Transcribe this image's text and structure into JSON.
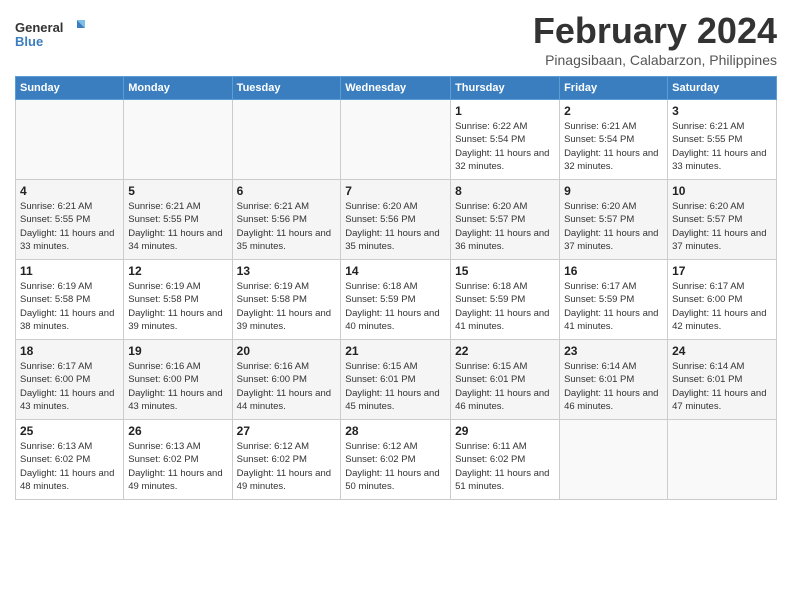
{
  "header": {
    "logo_line1": "General",
    "logo_line2": "Blue",
    "main_title": "February 2024",
    "subtitle": "Pinagsibaan, Calabarzon, Philippines"
  },
  "days_of_week": [
    "Sunday",
    "Monday",
    "Tuesday",
    "Wednesday",
    "Thursday",
    "Friday",
    "Saturday"
  ],
  "weeks": [
    [
      {
        "date": "",
        "sunrise": "",
        "sunset": "",
        "daylight": ""
      },
      {
        "date": "",
        "sunrise": "",
        "sunset": "",
        "daylight": ""
      },
      {
        "date": "",
        "sunrise": "",
        "sunset": "",
        "daylight": ""
      },
      {
        "date": "",
        "sunrise": "",
        "sunset": "",
        "daylight": ""
      },
      {
        "date": "1",
        "sunrise": "Sunrise: 6:22 AM",
        "sunset": "Sunset: 5:54 PM",
        "daylight": "Daylight: 11 hours and 32 minutes."
      },
      {
        "date": "2",
        "sunrise": "Sunrise: 6:21 AM",
        "sunset": "Sunset: 5:54 PM",
        "daylight": "Daylight: 11 hours and 32 minutes."
      },
      {
        "date": "3",
        "sunrise": "Sunrise: 6:21 AM",
        "sunset": "Sunset: 5:55 PM",
        "daylight": "Daylight: 11 hours and 33 minutes."
      }
    ],
    [
      {
        "date": "4",
        "sunrise": "Sunrise: 6:21 AM",
        "sunset": "Sunset: 5:55 PM",
        "daylight": "Daylight: 11 hours and 33 minutes."
      },
      {
        "date": "5",
        "sunrise": "Sunrise: 6:21 AM",
        "sunset": "Sunset: 5:55 PM",
        "daylight": "Daylight: 11 hours and 34 minutes."
      },
      {
        "date": "6",
        "sunrise": "Sunrise: 6:21 AM",
        "sunset": "Sunset: 5:56 PM",
        "daylight": "Daylight: 11 hours and 35 minutes."
      },
      {
        "date": "7",
        "sunrise": "Sunrise: 6:20 AM",
        "sunset": "Sunset: 5:56 PM",
        "daylight": "Daylight: 11 hours and 35 minutes."
      },
      {
        "date": "8",
        "sunrise": "Sunrise: 6:20 AM",
        "sunset": "Sunset: 5:57 PM",
        "daylight": "Daylight: 11 hours and 36 minutes."
      },
      {
        "date": "9",
        "sunrise": "Sunrise: 6:20 AM",
        "sunset": "Sunset: 5:57 PM",
        "daylight": "Daylight: 11 hours and 37 minutes."
      },
      {
        "date": "10",
        "sunrise": "Sunrise: 6:20 AM",
        "sunset": "Sunset: 5:57 PM",
        "daylight": "Daylight: 11 hours and 37 minutes."
      }
    ],
    [
      {
        "date": "11",
        "sunrise": "Sunrise: 6:19 AM",
        "sunset": "Sunset: 5:58 PM",
        "daylight": "Daylight: 11 hours and 38 minutes."
      },
      {
        "date": "12",
        "sunrise": "Sunrise: 6:19 AM",
        "sunset": "Sunset: 5:58 PM",
        "daylight": "Daylight: 11 hours and 39 minutes."
      },
      {
        "date": "13",
        "sunrise": "Sunrise: 6:19 AM",
        "sunset": "Sunset: 5:58 PM",
        "daylight": "Daylight: 11 hours and 39 minutes."
      },
      {
        "date": "14",
        "sunrise": "Sunrise: 6:18 AM",
        "sunset": "Sunset: 5:59 PM",
        "daylight": "Daylight: 11 hours and 40 minutes."
      },
      {
        "date": "15",
        "sunrise": "Sunrise: 6:18 AM",
        "sunset": "Sunset: 5:59 PM",
        "daylight": "Daylight: 11 hours and 41 minutes."
      },
      {
        "date": "16",
        "sunrise": "Sunrise: 6:17 AM",
        "sunset": "Sunset: 5:59 PM",
        "daylight": "Daylight: 11 hours and 41 minutes."
      },
      {
        "date": "17",
        "sunrise": "Sunrise: 6:17 AM",
        "sunset": "Sunset: 6:00 PM",
        "daylight": "Daylight: 11 hours and 42 minutes."
      }
    ],
    [
      {
        "date": "18",
        "sunrise": "Sunrise: 6:17 AM",
        "sunset": "Sunset: 6:00 PM",
        "daylight": "Daylight: 11 hours and 43 minutes."
      },
      {
        "date": "19",
        "sunrise": "Sunrise: 6:16 AM",
        "sunset": "Sunset: 6:00 PM",
        "daylight": "Daylight: 11 hours and 43 minutes."
      },
      {
        "date": "20",
        "sunrise": "Sunrise: 6:16 AM",
        "sunset": "Sunset: 6:00 PM",
        "daylight": "Daylight: 11 hours and 44 minutes."
      },
      {
        "date": "21",
        "sunrise": "Sunrise: 6:15 AM",
        "sunset": "Sunset: 6:01 PM",
        "daylight": "Daylight: 11 hours and 45 minutes."
      },
      {
        "date": "22",
        "sunrise": "Sunrise: 6:15 AM",
        "sunset": "Sunset: 6:01 PM",
        "daylight": "Daylight: 11 hours and 46 minutes."
      },
      {
        "date": "23",
        "sunrise": "Sunrise: 6:14 AM",
        "sunset": "Sunset: 6:01 PM",
        "daylight": "Daylight: 11 hours and 46 minutes."
      },
      {
        "date": "24",
        "sunrise": "Sunrise: 6:14 AM",
        "sunset": "Sunset: 6:01 PM",
        "daylight": "Daylight: 11 hours and 47 minutes."
      }
    ],
    [
      {
        "date": "25",
        "sunrise": "Sunrise: 6:13 AM",
        "sunset": "Sunset: 6:02 PM",
        "daylight": "Daylight: 11 hours and 48 minutes."
      },
      {
        "date": "26",
        "sunrise": "Sunrise: 6:13 AM",
        "sunset": "Sunset: 6:02 PM",
        "daylight": "Daylight: 11 hours and 49 minutes."
      },
      {
        "date": "27",
        "sunrise": "Sunrise: 6:12 AM",
        "sunset": "Sunset: 6:02 PM",
        "daylight": "Daylight: 11 hours and 49 minutes."
      },
      {
        "date": "28",
        "sunrise": "Sunrise: 6:12 AM",
        "sunset": "Sunset: 6:02 PM",
        "daylight": "Daylight: 11 hours and 50 minutes."
      },
      {
        "date": "29",
        "sunrise": "Sunrise: 6:11 AM",
        "sunset": "Sunset: 6:02 PM",
        "daylight": "Daylight: 11 hours and 51 minutes."
      },
      {
        "date": "",
        "sunrise": "",
        "sunset": "",
        "daylight": ""
      },
      {
        "date": "",
        "sunrise": "",
        "sunset": "",
        "daylight": ""
      }
    ]
  ]
}
